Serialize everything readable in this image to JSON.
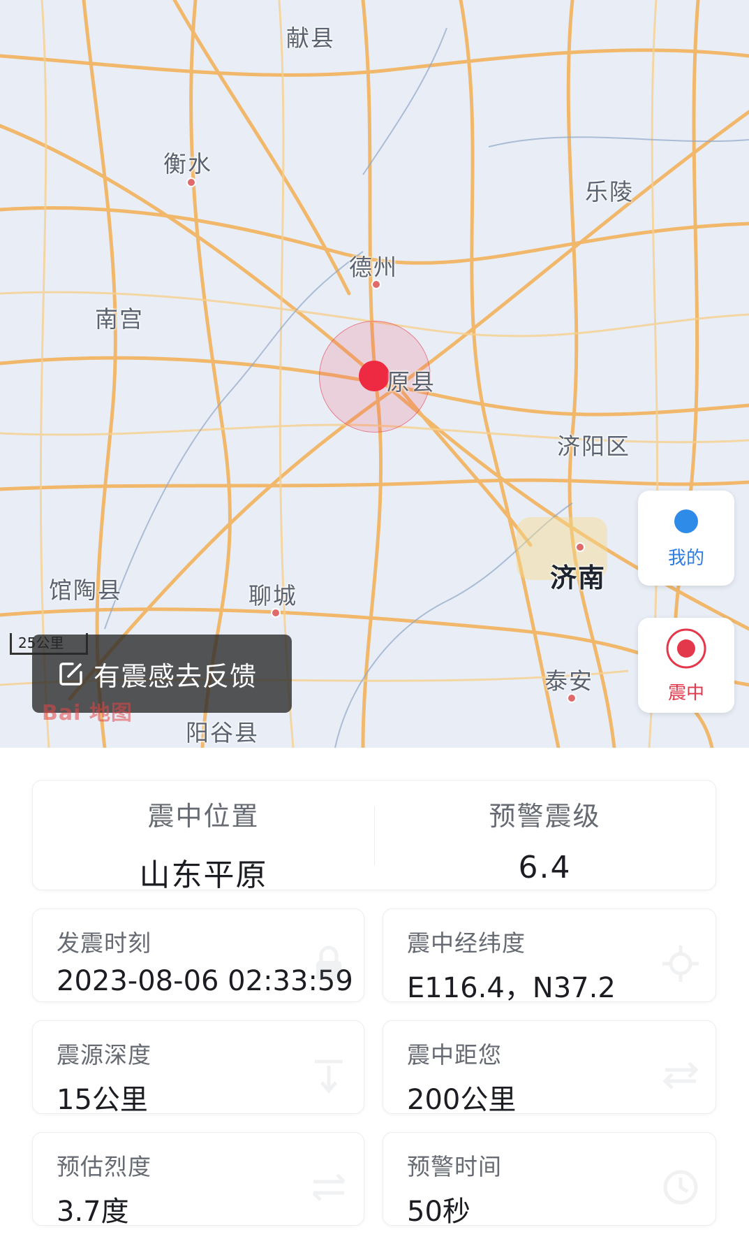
{
  "map": {
    "cities": [
      {
        "name": "献县",
        "big": false
      },
      {
        "name": "衡水",
        "big": false
      },
      {
        "name": "乐陵",
        "big": false
      },
      {
        "name": "德州",
        "big": false
      },
      {
        "name": "南宫",
        "big": false
      },
      {
        "name": "原县",
        "big": false
      },
      {
        "name": "济阳区",
        "big": false
      },
      {
        "name": "济南",
        "big": true
      },
      {
        "name": "馆陶县",
        "big": false
      },
      {
        "name": "聊城",
        "big": false
      },
      {
        "name": "泰安",
        "big": false
      },
      {
        "name": "阳谷县",
        "big": false
      }
    ],
    "scale_label": "25公里",
    "feedback_label": "有震感去反馈",
    "watermark": "Bai 地图",
    "btn_mine_label": "我的",
    "btn_epicenter_label": "震中",
    "colors": {
      "epicenter": "#ee2a43",
      "mine": "#2f7de1",
      "road": "#f2b35e"
    }
  },
  "summary": {
    "location_label": "震中位置",
    "location_value": "山东平原",
    "magnitude_label": "预警震级",
    "magnitude_value": "6.4"
  },
  "stats": [
    {
      "label": "发震时刻",
      "value": "2023-08-06 02:33:59",
      "icon": "clock-lock-icon"
    },
    {
      "label": "震中经纬度",
      "value": "E116.4，N37.2",
      "icon": "crosshair-icon"
    },
    {
      "label": "震源深度",
      "value": "15公里",
      "icon": "depth-arrow-icon"
    },
    {
      "label": "震中距您",
      "value": "200公里",
      "icon": "distance-icon"
    },
    {
      "label": "预估烈度",
      "value": "3.7度",
      "icon": "intensity-icon"
    },
    {
      "label": "预警时间",
      "value": "50秒",
      "icon": "timer-icon"
    }
  ]
}
